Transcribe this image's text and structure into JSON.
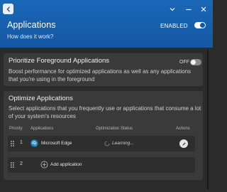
{
  "header": {
    "title": "Applications",
    "how_link": "How does it work?",
    "enabled_label": "ENABLED",
    "enabled": true,
    "accent": "#1558a3"
  },
  "window_controls": [
    "chevron-down-icon",
    "minimize-icon",
    "close-icon"
  ],
  "foreground": {
    "title": "Prioritize Foreground Applications",
    "toggle_label": "OFF",
    "enabled": false,
    "description": "Boost performance for optimized applications as well as any applications that you're using in the foreground"
  },
  "optimize": {
    "title": "Optimize Applications",
    "description": "Select applications that you frequently use or applications that consume a lot of your system's resources",
    "columns": {
      "priority": "Priority",
      "applications": "Applications",
      "status": "Optimization Status",
      "actions": "Actions"
    },
    "rows": [
      {
        "priority": "1",
        "name": "Microsoft Edge",
        "status": "Learning...",
        "icon": "edge-icon",
        "action_icon": "edit-icon"
      }
    ],
    "add_row": {
      "priority": "2",
      "label": "Add application"
    }
  }
}
